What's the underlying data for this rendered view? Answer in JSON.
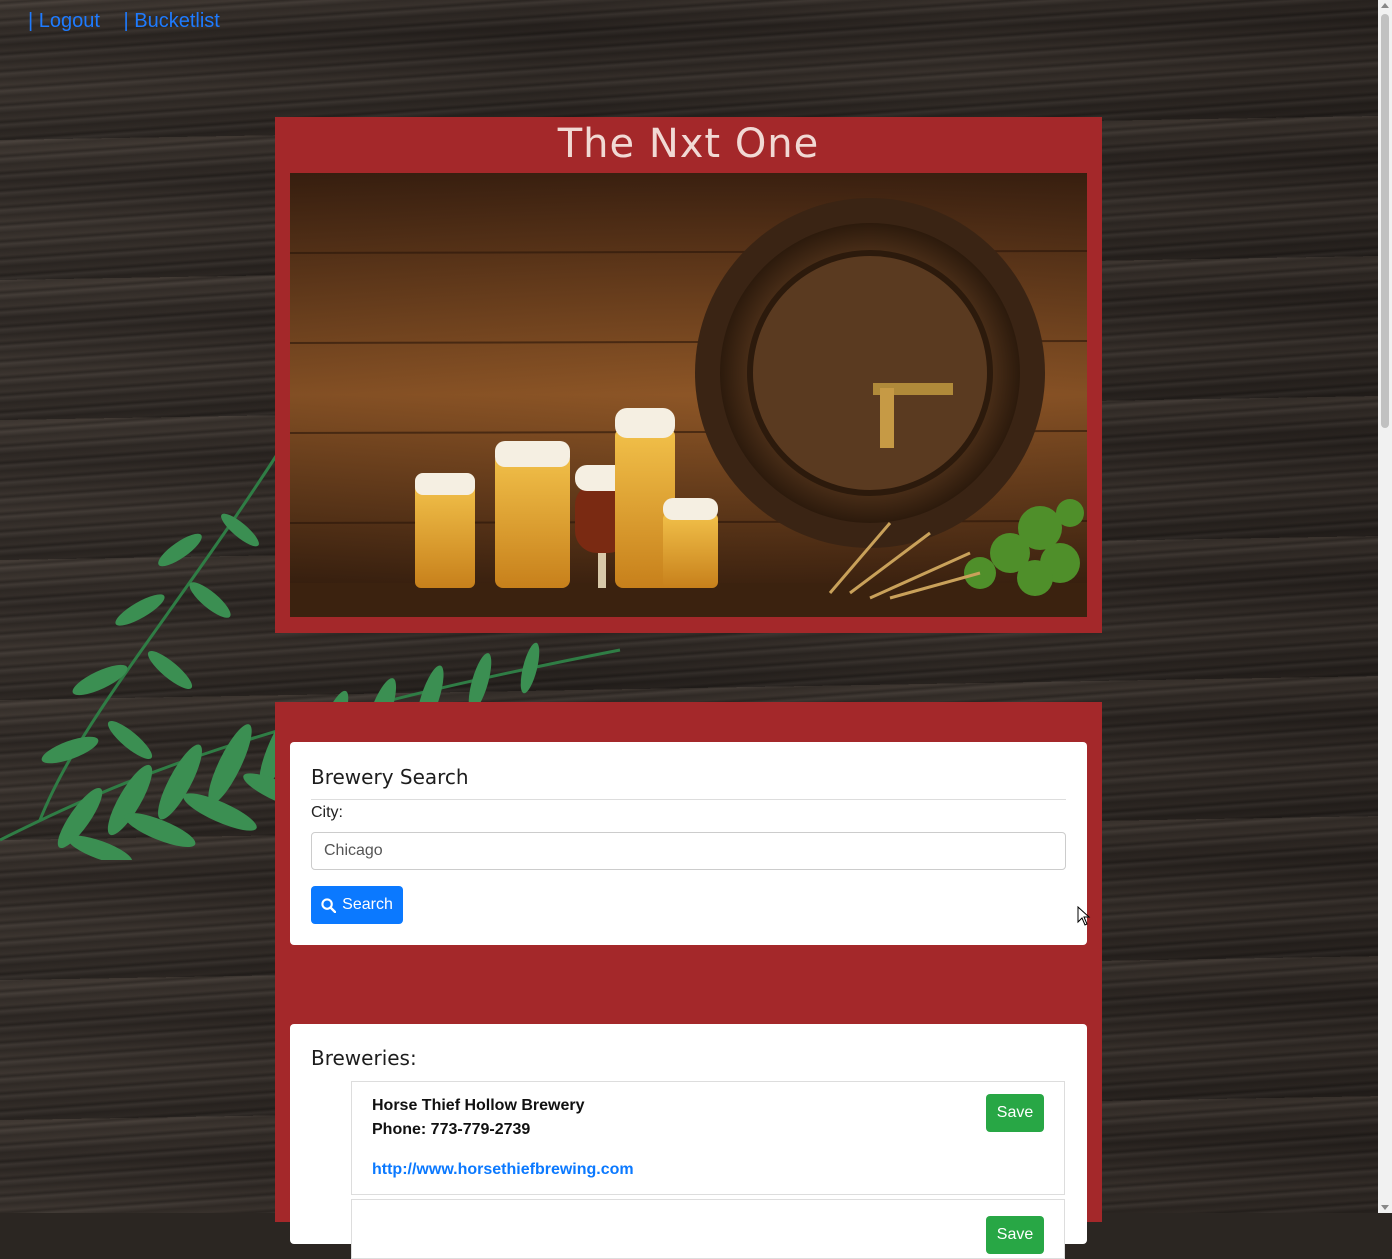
{
  "nav": {
    "logout": "| Logout",
    "bucketlist": "| Bucketlist"
  },
  "header": {
    "title": "The Nxt One",
    "hero_image": "beer-glasses-and-barrel-photo"
  },
  "search": {
    "title": "Brewery Search",
    "city_label": "City:",
    "city_value": "Chicago",
    "button_label": "Search",
    "button_icon": "search-icon"
  },
  "results": {
    "title": "Breweries:",
    "items": [
      {
        "name": "Horse Thief Hollow Brewery",
        "phone": "Phone: 773-779-2739",
        "url": "http://www.horsethiefbrewing.com",
        "save_label": "Save"
      },
      {
        "save_label": "Save"
      }
    ]
  },
  "colors": {
    "panel": "#a4282a",
    "link": "#1e7bff",
    "primary": "#0b79ff",
    "success": "#28a745"
  }
}
